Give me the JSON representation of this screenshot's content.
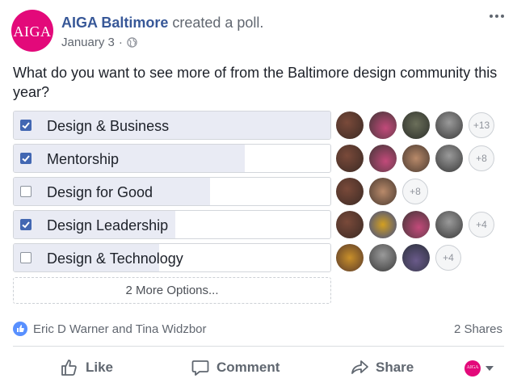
{
  "post": {
    "page_name": "AIGA Baltimore",
    "action": " created a poll.",
    "date": "January 3",
    "dot": "·",
    "logo_text": "AIGA",
    "question": "What do you want to see more of from the Baltimore design community this year?"
  },
  "poll": {
    "options": [
      {
        "label": "Design & Business",
        "checked": true,
        "fill_fraction": 1.0,
        "more_count": "+13"
      },
      {
        "label": "Mentorship",
        "checked": true,
        "fill_fraction": 0.73,
        "more_count": "+8"
      },
      {
        "label": "Design for Good",
        "checked": false,
        "fill_fraction": 0.62,
        "more_count": "+8"
      },
      {
        "label": "Design Leadership",
        "checked": true,
        "fill_fraction": 0.51,
        "more_count": "+4"
      },
      {
        "label": "Design & Technology",
        "checked": false,
        "fill_fraction": 0.46,
        "more_count": "+4"
      }
    ],
    "more_options_label": "2 More Options..."
  },
  "footer": {
    "reactors": "Eric D Warner and Tina Widzbor",
    "shares": "2 Shares",
    "like_label": "Like",
    "comment_label": "Comment",
    "share_label": "Share"
  },
  "colors": {
    "brand_magenta": "#e3097a",
    "link_blue": "#385898",
    "checkbox_blue": "#4267b2",
    "vote_fill": "#e9ebf4"
  }
}
